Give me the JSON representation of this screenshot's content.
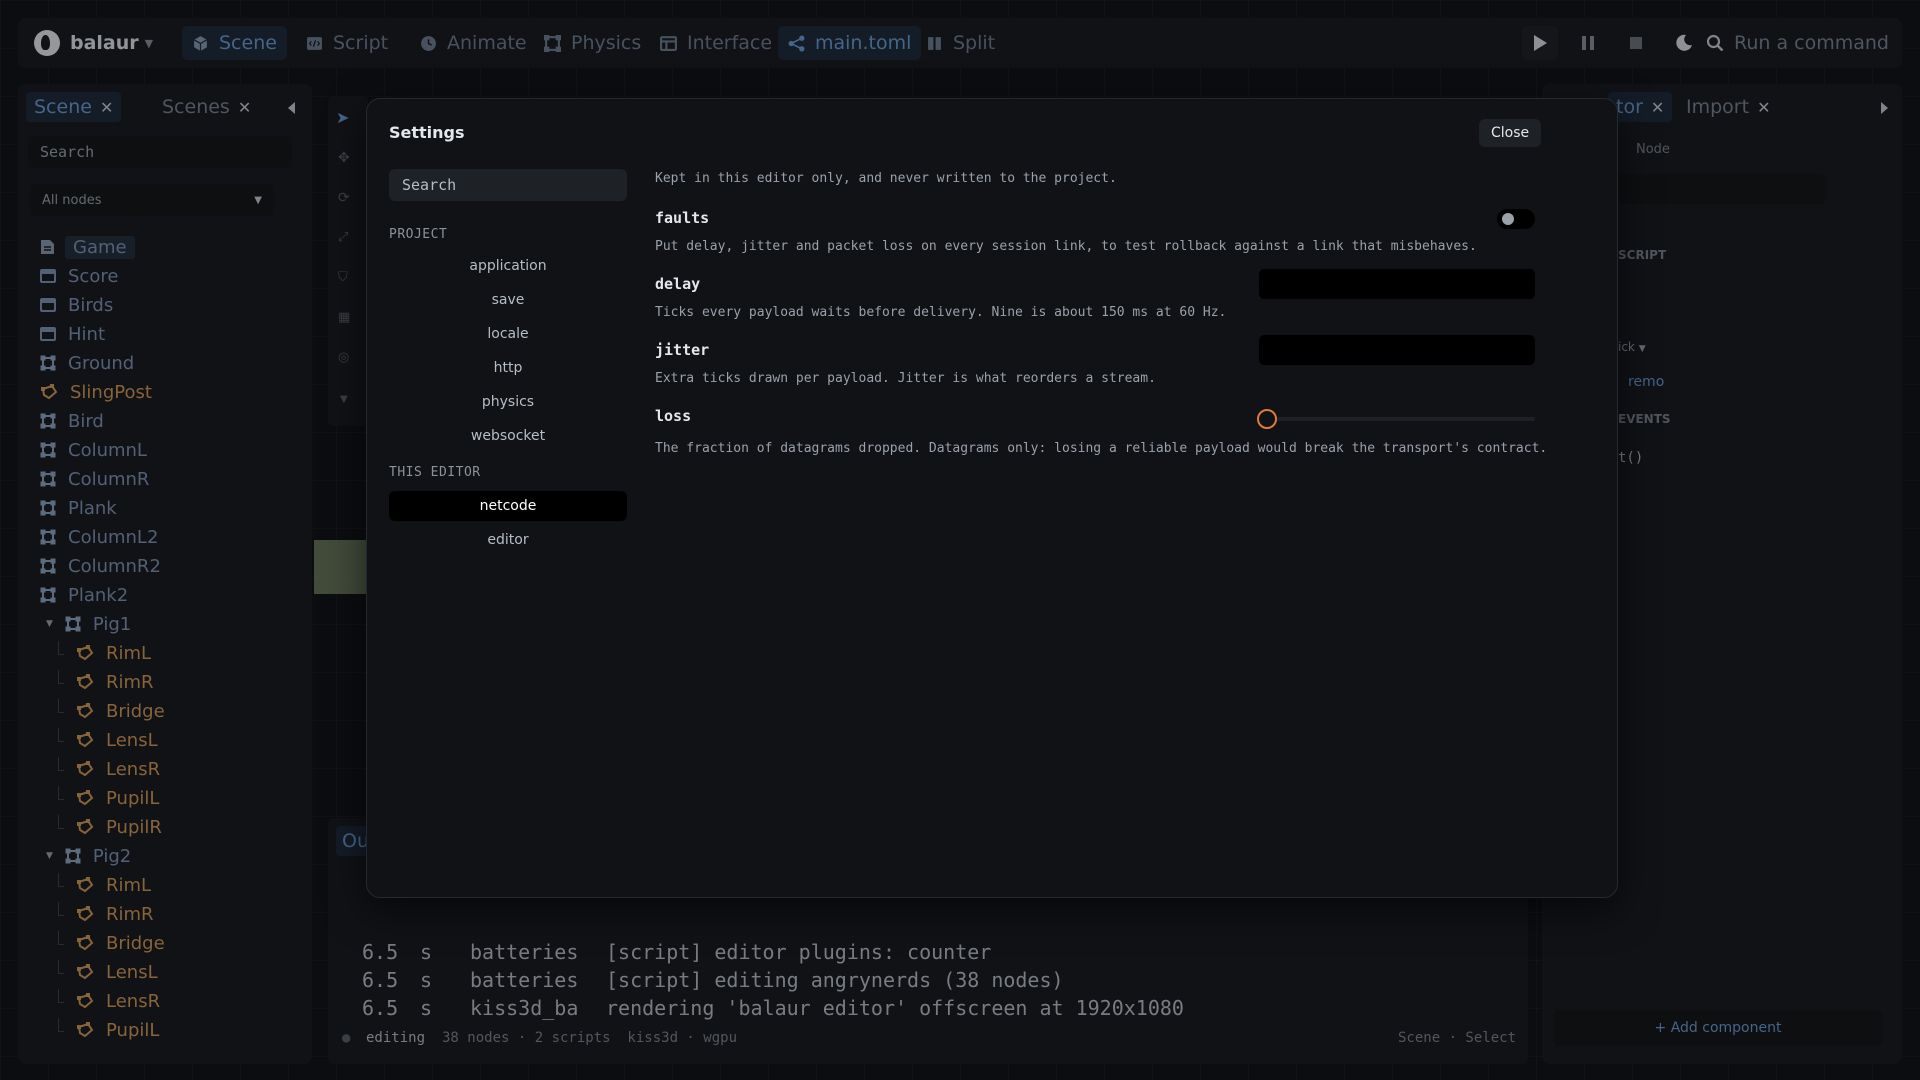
{
  "topbar": {
    "brand": "balaur",
    "items": [
      {
        "label": "Scene",
        "icon": "cube-icon"
      },
      {
        "label": "Script",
        "icon": "code-icon"
      },
      {
        "label": "Animate",
        "icon": "clock-icon"
      },
      {
        "label": "Physics",
        "icon": "joints-icon"
      },
      {
        "label": "Interface",
        "icon": "layout-icon"
      },
      {
        "label": "main.toml",
        "icon": "graph-icon"
      },
      {
        "label": "Split",
        "icon": "columns-icon"
      }
    ],
    "command_placeholder": "Run a command"
  },
  "left_panel": {
    "tabs": [
      "Scene",
      "Scenes"
    ],
    "search_placeholder": "Search",
    "filter_value": "All nodes",
    "tree": [
      {
        "label": "Game",
        "kind": "doc",
        "indent": 0,
        "selected": true
      },
      {
        "label": "Score",
        "kind": "panel",
        "indent": 0
      },
      {
        "label": "Birds",
        "kind": "panel",
        "indent": 0
      },
      {
        "label": "Hint",
        "kind": "panel",
        "indent": 0
      },
      {
        "label": "Ground",
        "kind": "body",
        "indent": 0
      },
      {
        "label": "SlingPost",
        "kind": "shape",
        "indent": 0
      },
      {
        "label": "Bird",
        "kind": "body",
        "indent": 0
      },
      {
        "label": "ColumnL",
        "kind": "body",
        "indent": 0
      },
      {
        "label": "ColumnR",
        "kind": "body",
        "indent": 0
      },
      {
        "label": "Plank",
        "kind": "body",
        "indent": 0
      },
      {
        "label": "ColumnL2",
        "kind": "body",
        "indent": 0
      },
      {
        "label": "ColumnR2",
        "kind": "body",
        "indent": 0
      },
      {
        "label": "Plank2",
        "kind": "body",
        "indent": 0
      },
      {
        "label": "Pig1",
        "kind": "body",
        "indent": 1,
        "expanded": true
      },
      {
        "label": "RimL",
        "kind": "shape",
        "indent": 2
      },
      {
        "label": "RimR",
        "kind": "shape",
        "indent": 2
      },
      {
        "label": "Bridge",
        "kind": "shape",
        "indent": 2
      },
      {
        "label": "LensL",
        "kind": "shape",
        "indent": 2
      },
      {
        "label": "LensR",
        "kind": "shape",
        "indent": 2
      },
      {
        "label": "PupilL",
        "kind": "shape",
        "indent": 2
      },
      {
        "label": "PupilR",
        "kind": "shape",
        "indent": 2
      },
      {
        "label": "Pig2",
        "kind": "body",
        "indent": 1,
        "expanded": true
      },
      {
        "label": "RimL",
        "kind": "shape",
        "indent": 2
      },
      {
        "label": "RimR",
        "kind": "shape",
        "indent": 2
      },
      {
        "label": "Bridge",
        "kind": "shape",
        "indent": 2
      },
      {
        "label": "LensL",
        "kind": "shape",
        "indent": 2
      },
      {
        "label": "LensR",
        "kind": "shape",
        "indent": 2
      },
      {
        "label": "PupilL",
        "kind": "shape",
        "indent": 2
      }
    ]
  },
  "right_panel": {
    "tabs": [
      "tor",
      "Import"
    ],
    "node_label": "Node",
    "section_script": "SCRIPT",
    "pick_label": "ick",
    "remove_label": "remo",
    "section_events": "EVENTS",
    "event_code": "t()",
    "add_component": "+ Add component"
  },
  "output": {
    "tab_label": "Ou",
    "lines": [
      {
        "time": "6.5",
        "unit": "s",
        "source": "batteries",
        "message": "[script] editor plugins: counter"
      },
      {
        "time": "6.5",
        "unit": "s",
        "source": "batteries",
        "message": "[script] editing angrynerds (38 nodes)"
      },
      {
        "time": "6.5",
        "unit": "s",
        "source": "kiss3d_ba",
        "message": "rendering 'balaur editor' offscreen at 1920x1080"
      }
    ],
    "status_mode": "editing",
    "status_info": "38 nodes · 2 scripts  kiss3d · wgpu",
    "status_right": "Scene · Select"
  },
  "settings": {
    "title": "Settings",
    "close_label": "Close",
    "search_placeholder": "Search",
    "section_project": "PROJECT",
    "project_items": [
      "application",
      "save",
      "locale",
      "http",
      "physics",
      "websocket"
    ],
    "section_editor": "THIS EDITOR",
    "editor_items": [
      "netcode",
      "editor"
    ],
    "active_item": "netcode",
    "intro": "Kept in this editor only, and never written to the project.",
    "faults": {
      "label": "faults",
      "desc": "Put delay, jitter and packet loss on every session link, to test rollback against a link that misbehaves.",
      "enabled": false
    },
    "delay": {
      "label": "delay",
      "desc": "Ticks every payload waits before delivery. Nine is about 150 ms at 60 Hz.",
      "value": ""
    },
    "jitter": {
      "label": "jitter",
      "desc": "Extra ticks drawn per payload. Jitter is what reorders a stream.",
      "value": ""
    },
    "loss": {
      "label": "loss",
      "desc": "The fraction of datagrams dropped. Datagrams only: losing a reliable payload would break the transport's contract.",
      "value": 0
    }
  },
  "colors": {
    "accent": "#6a9bd3",
    "slider": "#e07a3c",
    "body_node": "#7e95b6",
    "shape_node": "#cf9a5a"
  }
}
